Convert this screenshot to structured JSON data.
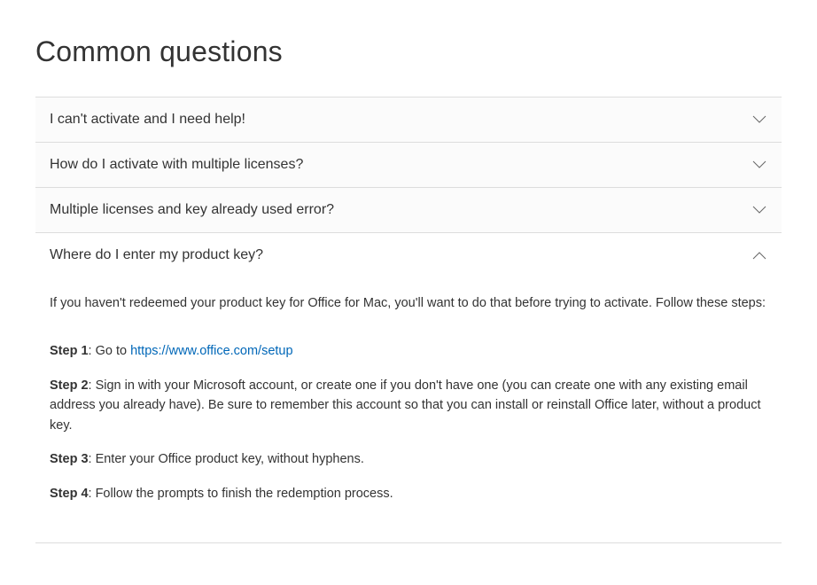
{
  "page_title": "Common questions",
  "accordion": [
    {
      "title": "I can't activate and I need help!",
      "expanded": false
    },
    {
      "title": "How do I activate with multiple licenses?",
      "expanded": false
    },
    {
      "title": "Multiple licenses and key already used error?",
      "expanded": false
    },
    {
      "title": "Where do I enter my product key?",
      "expanded": true,
      "content": {
        "intro": "If you haven't redeemed your product key for Office for Mac, you'll want to do that before trying to activate. Follow these steps:",
        "steps": [
          {
            "label": "Step 1",
            "prefix": ": Go to ",
            "link_text": "https://www.office.com/setup",
            "suffix": ""
          },
          {
            "label": "Step 2",
            "text": ": Sign in with your Microsoft account, or create one if you don't have one (you can create one with any existing email address you already have). Be sure to remember this account so that you can install or reinstall Office later, without a product key."
          },
          {
            "label": "Step 3",
            "text": ": Enter your Office product key, without hyphens."
          },
          {
            "label": "Step 4",
            "text": ": Follow the prompts to finish the redemption process."
          }
        ]
      }
    }
  ]
}
